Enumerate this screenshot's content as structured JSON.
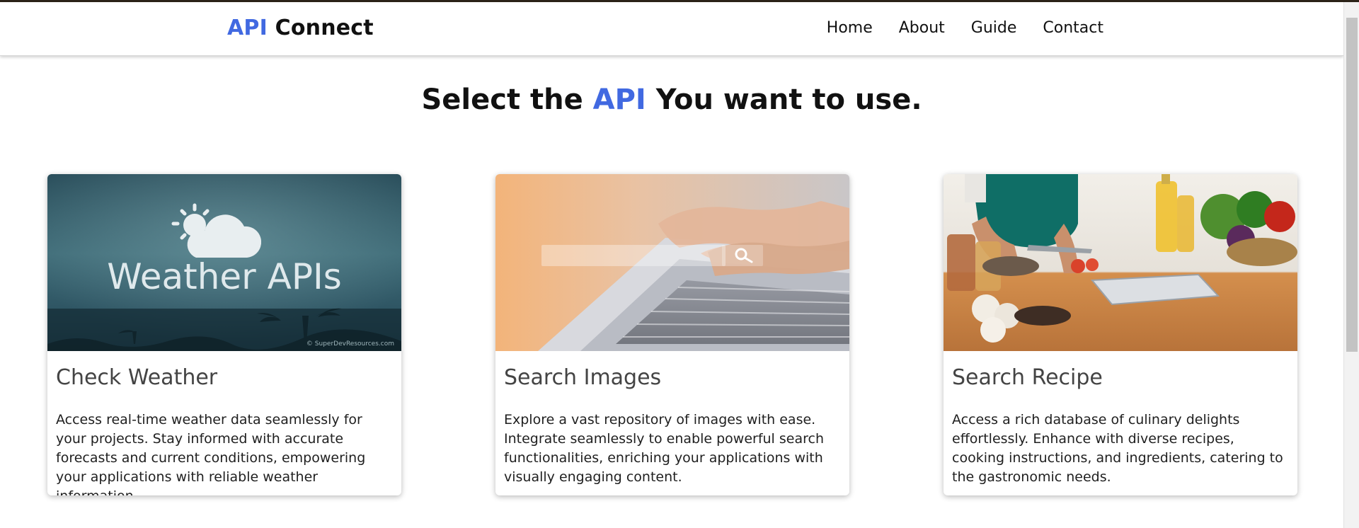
{
  "header": {
    "logo_accent": "API",
    "logo_rest": " Connect",
    "nav": [
      "Home",
      "About",
      "Guide",
      "Contact"
    ]
  },
  "headline": {
    "before": "Select the ",
    "accent": "API",
    "after": " You want to use."
  },
  "cards": [
    {
      "image_text": "Weather APIs",
      "image_credit": "© SuperDevResources.com",
      "title": "Check Weather",
      "description": "Access real-time weather data seamlessly for your projects. Stay informed with accurate forecasts and current conditions, empowering your applications with reliable weather information."
    },
    {
      "title": "Search Images",
      "description": "Explore a vast repository of images with ease. Integrate seamlessly to enable powerful search functionalities, enriching your applications with visually engaging content."
    },
    {
      "title": "Search Recipe",
      "description": "Access a rich database of culinary delights effortlessly. Enhance with diverse recipes, cooking instructions, and ingredients, catering to the gastronomic needs."
    }
  ],
  "colors": {
    "accent": "#4169e1",
    "text": "#111111",
    "card_title": "#444444"
  },
  "icons": [
    "weather-sun-cloud-icon",
    "magnifier-icon"
  ]
}
